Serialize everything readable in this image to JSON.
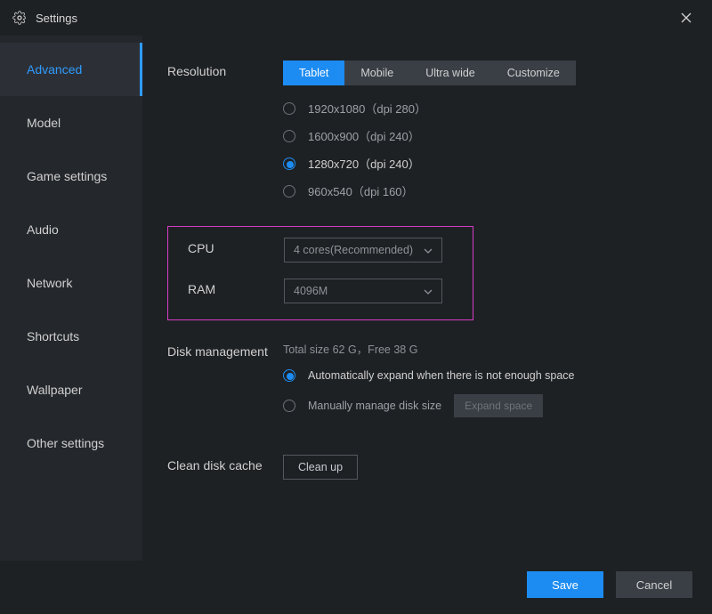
{
  "titlebar": {
    "title": "Settings"
  },
  "sidebar": {
    "items": [
      {
        "label": "Advanced",
        "active": true
      },
      {
        "label": "Model",
        "active": false
      },
      {
        "label": "Game settings",
        "active": false
      },
      {
        "label": "Audio",
        "active": false
      },
      {
        "label": "Network",
        "active": false
      },
      {
        "label": "Shortcuts",
        "active": false
      },
      {
        "label": "Wallpaper",
        "active": false
      },
      {
        "label": "Other settings",
        "active": false
      }
    ]
  },
  "resolution": {
    "label": "Resolution",
    "tabs": [
      {
        "label": "Tablet",
        "active": true
      },
      {
        "label": "Mobile",
        "active": false
      },
      {
        "label": "Ultra wide",
        "active": false
      },
      {
        "label": "Customize",
        "active": false
      }
    ],
    "options": [
      {
        "label": "1920x1080（dpi 280）",
        "selected": false
      },
      {
        "label": "1600x900（dpi 240）",
        "selected": false
      },
      {
        "label": "1280x720（dpi 240）",
        "selected": true
      },
      {
        "label": "960x540（dpi 160）",
        "selected": false
      }
    ]
  },
  "cpu": {
    "label": "CPU",
    "value": "4 cores(Recommended)"
  },
  "ram": {
    "label": "RAM",
    "value": "4096M"
  },
  "disk": {
    "label": "Disk management",
    "info": "Total size 62 G，Free 38 G",
    "opt_auto": "Automatically expand when there is not enough space",
    "opt_manual": "Manually manage disk size",
    "expand_btn": "Expand space"
  },
  "clean": {
    "label": "Clean disk cache",
    "btn": "Clean up"
  },
  "footer": {
    "save": "Save",
    "cancel": "Cancel"
  }
}
